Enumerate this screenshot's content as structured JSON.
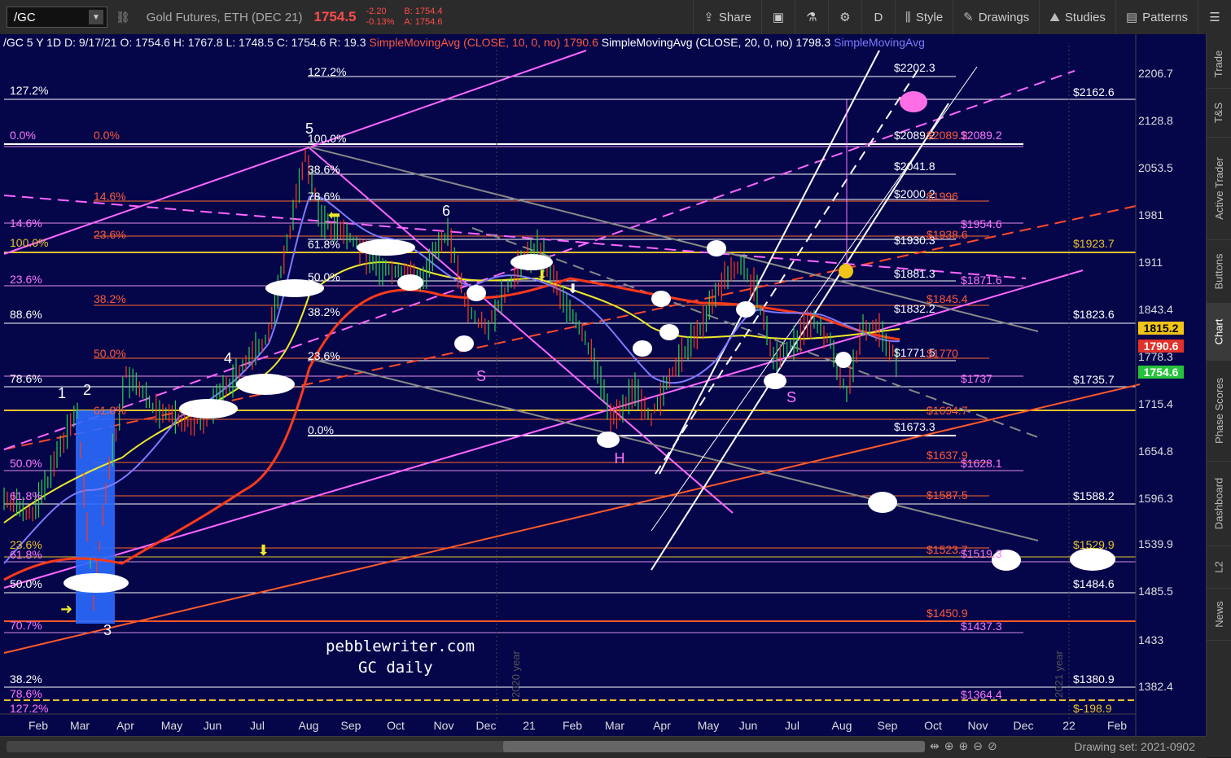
{
  "toolbar": {
    "symbol": "/GC",
    "description": "Gold Futures, ETH (DEC 21)",
    "last": "1754.5",
    "change": "-2.20",
    "change_pct": "-0.13%",
    "bid": "B: 1754.4",
    "ask": "A: 1754.6",
    "share": "Share",
    "aggregation": "D",
    "style": "Style",
    "drawings": "Drawings",
    "studies": "Studies",
    "patterns": "Patterns"
  },
  "chart_header": {
    "symbol_period": "/GC 5 Y 1D",
    "date": "D: 9/17/21",
    "open": "O: 1754.6",
    "high": "H: 1767.8",
    "low": "L: 1748.5",
    "close": "C: 1754.6",
    "range": "R: 19.3",
    "sma10": "SimpleMovingAvg (CLOSE, 10, 0, no)",
    "sma10_val": "1790.6",
    "sma20": "SimpleMovingAvg (CLOSE, 20, 0, no)",
    "sma20_val": "1798.3",
    "sma_other": "SimpleMovingAvg"
  },
  "price_axis": [
    "2206.7",
    "2128.8",
    "2053.5",
    "1981",
    "1911",
    "1843.4",
    "1778.3",
    "1715.4",
    "1654.8",
    "1596.3",
    "1539.9",
    "1485.5",
    "1433",
    "1382.4"
  ],
  "price_badges": [
    {
      "value": "1815.2",
      "color": "#f0c419"
    },
    {
      "value": "1790.6",
      "color": "#e0312a"
    },
    {
      "value": "1754.6",
      "color": "#27c23b"
    }
  ],
  "time_axis": [
    "Feb",
    "Mar",
    "Apr",
    "May",
    "Jun",
    "Jul",
    "Aug",
    "Sep",
    "Oct",
    "Nov",
    "Dec",
    "21",
    "Feb",
    "Mar",
    "Apr",
    "May",
    "Jun",
    "Jul",
    "Aug",
    "Sep",
    "Oct",
    "Nov",
    "Dec",
    "22",
    "Feb"
  ],
  "right_labels_white": [
    "$2202.3",
    "$2089.2",
    "$2041.8",
    "$2000.2",
    "$1930.3",
    "$1881.3",
    "$1832.2",
    "$1771.5",
    "$1673.3"
  ],
  "right_labels_axis": [
    "$2162.6",
    "$1923.7",
    "$1823.6",
    "$1735.7",
    "$1588.2",
    "$1529.9",
    "$1484.6",
    "$1380.9",
    "$-198.9"
  ],
  "right_labels_red": [
    "$2089.2",
    "$1996",
    "$1938.6",
    "$1845.4",
    "$1770",
    "$1694.7",
    "$1637.9",
    "$1587.5",
    "$1523.7",
    "$1450.9"
  ],
  "right_labels_pink": [
    "$2089.2",
    "$1954.6",
    "$1871.6",
    "$1737",
    "$1628.1",
    "$1519.3",
    "$1437.3",
    "$1364.4"
  ],
  "left_fib_labels": [
    "127.2%",
    "0.0%",
    "0.0%",
    "14.6%",
    "14.6%",
    "23.6%",
    "100.0%",
    "23.6%",
    "38.2%",
    "88.6%",
    "50.0%",
    "78.6%",
    "61.8%",
    "50.0%",
    "61.8%",
    "23.6%",
    "61.8%",
    "50.0%",
    "70.7%",
    "38.2%",
    "78.6%",
    "127.2%"
  ],
  "mid_fib_labels": [
    "127.2%",
    "100.0%",
    "38.6%",
    "78.6%",
    "61.8%",
    "50.0%",
    "38.2%",
    "23.6%",
    "0.0%"
  ],
  "wave_labels": [
    "1",
    "2",
    "3",
    "4",
    "5",
    "6",
    "S",
    "H",
    "S"
  ],
  "watermark": {
    "line1": "pebblewriter.com",
    "line2": "GC daily"
  },
  "year_markers": [
    "2020 year",
    "2021 year"
  ],
  "bottom_bar": {
    "drawing_set": "Drawing set: 2021-0902"
  },
  "right_tabs": [
    "Trade",
    "T&S",
    "Active Trader",
    "Buttons",
    "Chart",
    "Phase Scores",
    "Dashboard",
    "L2",
    "News"
  ]
}
